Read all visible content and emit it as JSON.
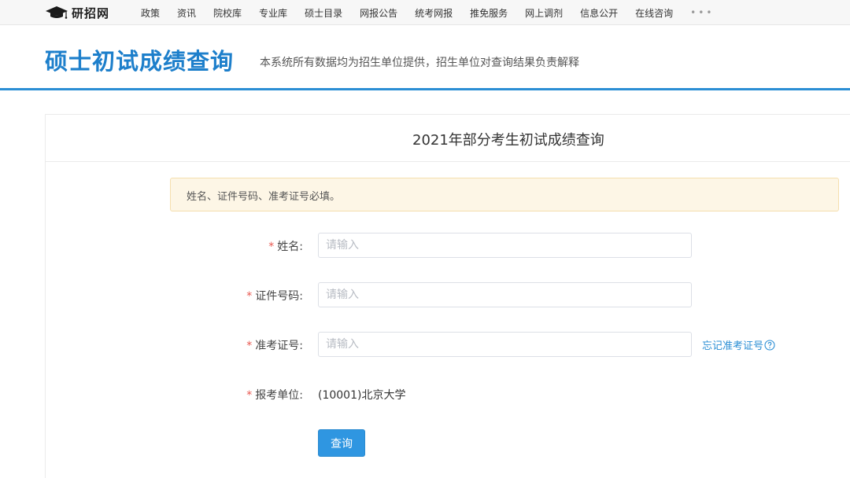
{
  "topnav": {
    "logo_text": "研招网",
    "items": [
      "政策",
      "资讯",
      "院校库",
      "专业库",
      "硕士目录",
      "网报公告",
      "统考网报",
      "推免服务",
      "网上调剂",
      "信息公开",
      "在线咨询"
    ],
    "more": "•••"
  },
  "header": {
    "title": "硕士初试成绩查询",
    "subtitle": "本系统所有数据均为招生单位提供，招生单位对查询结果负责解释"
  },
  "card": {
    "title": "2021年部分考生初试成绩查询",
    "alert": "姓名、证件号码、准考证号必填。"
  },
  "form": {
    "required_mark": "*",
    "name": {
      "label": "姓名:",
      "placeholder": "请输入",
      "value": ""
    },
    "id_number": {
      "label": "证件号码:",
      "placeholder": "请输入",
      "value": ""
    },
    "exam_number": {
      "label": "准考证号:",
      "placeholder": "请输入",
      "value": ""
    },
    "forgot_link": "忘记准考证号",
    "unit": {
      "label": "报考单位:",
      "value": "(10001)北京大学"
    },
    "submit_label": "查询"
  },
  "colors": {
    "brand_blue": "#1d7fcb",
    "accent_blue": "#2f96e1",
    "required_red": "#e8574f",
    "alert_bg": "#fdf6e6"
  },
  "icons": {
    "logo": "graduation-cap-icon",
    "forgot_help": "question-circle-icon"
  }
}
